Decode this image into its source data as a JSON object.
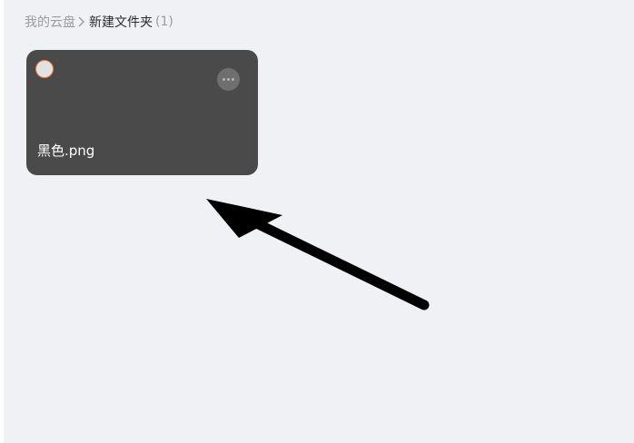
{
  "breadcrumb": {
    "root": "我的云盘",
    "current": "新建文件夹",
    "count": "(1)"
  },
  "file": {
    "name": "黑色.png"
  },
  "icons": {
    "chevron": "chevron-right-icon",
    "more": "more-horizontal-icon",
    "select": "checkbox-circle-icon",
    "annotation": "arrow-pointer-icon"
  },
  "colors": {
    "background": "#f0f1f4",
    "card": "#4a4a4a",
    "select_border": "#f07a3a",
    "arrow": "#000000"
  }
}
